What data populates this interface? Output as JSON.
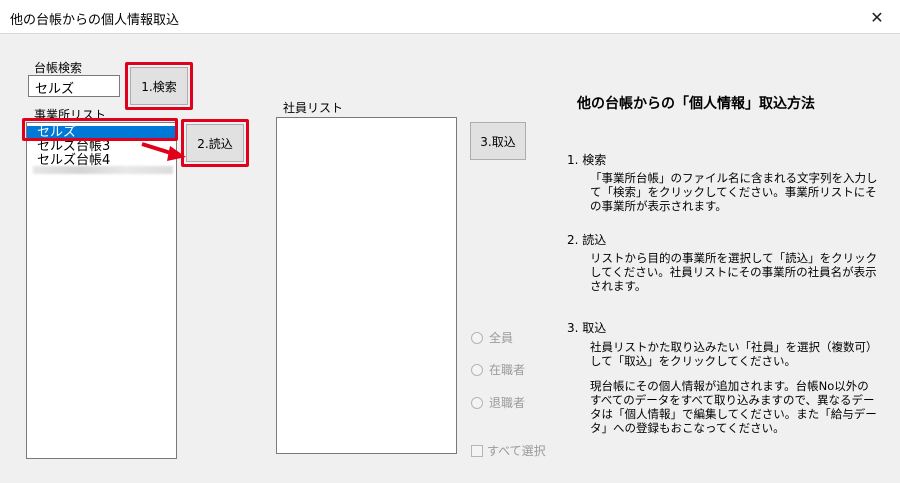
{
  "window": {
    "title": "他の台帳からの個人情報取込",
    "close_glyph": "✕"
  },
  "search": {
    "label": "台帳検索",
    "value": "セルズ",
    "button": "1.検索"
  },
  "office_list": {
    "label": "事業所リスト",
    "items": [
      "セルズ",
      "セルズ台帳3",
      "セルズ台帳4"
    ],
    "selected_index": 0
  },
  "load_button": "2.読込",
  "employee_list": {
    "label": "社員リスト"
  },
  "import_button": "3.取込",
  "filter": {
    "options": [
      "全員",
      "在職者",
      "退職者"
    ],
    "select_all": "すべて選択"
  },
  "help": {
    "title": "他の台帳からの「個人情報」取込方法",
    "steps": [
      {
        "heading": "1. 検索",
        "paragraphs": [
          "「事業所台帳」のファイル名に含まれる文字列を入力して「検索」をクリックしてください。事業所リストにその事業所が表示されます。"
        ]
      },
      {
        "heading": "2. 読込",
        "paragraphs": [
          "リストから目的の事業所を選択して「読込」をクリックしてください。社員リストにその事業所の社員名が表示されます。"
        ]
      },
      {
        "heading": "3. 取込",
        "paragraphs": [
          "社員リストかた取り込みたい「社員」を選択（複数可）して「取込」をクリックしてください。",
          "現台帳にその個人情報が追加されます。台帳No以外のすべてのデータをすべて取り込みますので、異なるデータは「個人情報」で編集してください。また「給与データ」への登録もおこなってください。"
        ]
      }
    ]
  },
  "colors": {
    "annotation": "#e0001b",
    "selection": "#0078d7"
  }
}
